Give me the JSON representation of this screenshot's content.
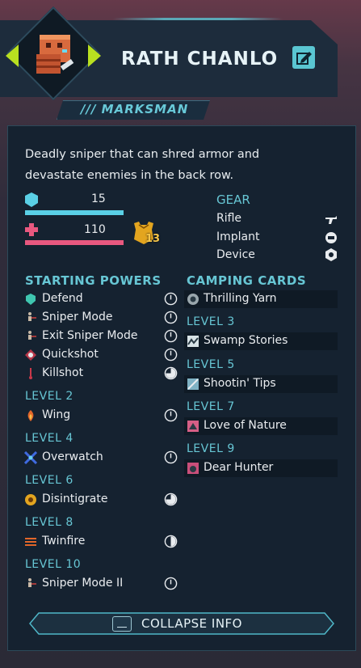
{
  "character": {
    "name": "RATH CHANLO",
    "class": "/// MARKSMAN",
    "description_line1": "Deadly sniper that can shred armor and",
    "description_line2": "devastate enemies in the back row."
  },
  "stats": {
    "shield": "15",
    "health": "110",
    "armor_badge": "13"
  },
  "gear": {
    "title": "GEAR",
    "items": [
      {
        "label": "Rifle",
        "icon": "rifle-icon"
      },
      {
        "label": "Implant",
        "icon": "implant-icon"
      },
      {
        "label": "Device",
        "icon": "device-icon"
      }
    ]
  },
  "starting_powers": {
    "title": "STARTING POWERS",
    "items": [
      {
        "label": "Defend",
        "icon": "defend-icon",
        "cost": "one"
      },
      {
        "label": "Sniper Mode",
        "icon": "sniper-mode-icon",
        "cost": "one"
      },
      {
        "label": "Exit Sniper Mode",
        "icon": "exit-sniper-mode-icon",
        "cost": "one"
      },
      {
        "label": "Quickshot",
        "icon": "quickshot-icon",
        "cost": "one"
      },
      {
        "label": "Killshot",
        "icon": "killshot-icon",
        "cost": "three-quarter"
      }
    ]
  },
  "power_levels": [
    {
      "level": "LEVEL 2",
      "label": "Wing",
      "icon": "wing-icon",
      "cost": "one"
    },
    {
      "level": "LEVEL 4",
      "label": "Overwatch",
      "icon": "overwatch-icon",
      "cost": "one"
    },
    {
      "level": "LEVEL 6",
      "label": "Disintigrate",
      "icon": "disintigrate-icon",
      "cost": "three-quarter"
    },
    {
      "level": "LEVEL 8",
      "label": "Twinfire",
      "icon": "twinfire-icon",
      "cost": "half"
    },
    {
      "level": "LEVEL 10",
      "label": "Sniper Mode II",
      "icon": "sniper-mode-icon",
      "cost": "one"
    }
  ],
  "camping_cards": {
    "title": "CAMPING CARDS",
    "start": {
      "label": "Thrilling Yarn",
      "icon": "thrilling-yarn-icon"
    },
    "levels": [
      {
        "level": "LEVEL 3",
        "label": "Swamp Stories",
        "icon": "swamp-stories-icon"
      },
      {
        "level": "LEVEL 5",
        "label": "Shootin' Tips",
        "icon": "shootin-tips-icon"
      },
      {
        "level": "LEVEL 7",
        "label": "Love of Nature",
        "icon": "love-of-nature-icon"
      },
      {
        "level": "LEVEL 9",
        "label": "Dear Hunter",
        "icon": "dear-hunter-icon"
      }
    ]
  },
  "footer": {
    "collapse_label": "COLLAPSE INFO"
  },
  "colors": {
    "accent": "#67c6d4",
    "shield": "#5ad0e6",
    "health": "#e8587f",
    "select": "#b9e020"
  }
}
